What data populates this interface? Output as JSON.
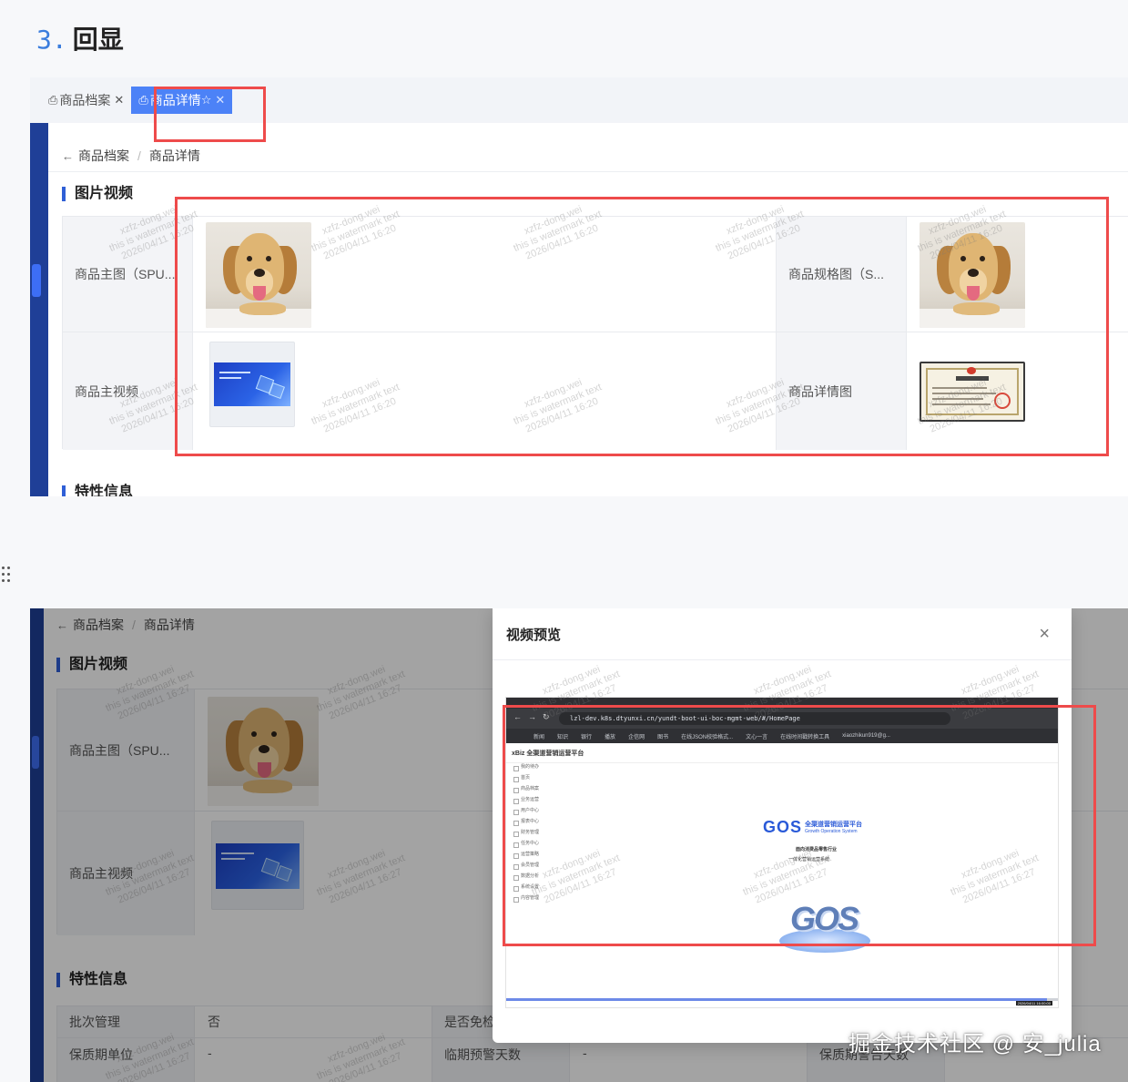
{
  "heading": {
    "number": "3.",
    "title": "回显"
  },
  "screenshot1": {
    "tabs": [
      {
        "label": "商品档案",
        "active": false
      },
      {
        "label": "商品详情",
        "active": true
      }
    ],
    "breadcrumb": {
      "back": "←",
      "parent": "商品档案",
      "separator": "/",
      "current": "商品详情"
    },
    "section_media": "图片视频",
    "section_attrs_partial": "特性信息",
    "rows": [
      {
        "label_left": "商品主图（SPU...",
        "label_right": "商品规格图（S..."
      },
      {
        "label_left": "商品主视频",
        "label_right": "商品详情图"
      }
    ]
  },
  "screenshot2": {
    "breadcrumb": {
      "back": "←",
      "parent": "商品档案",
      "separator": "/",
      "current": "商品详情"
    },
    "section_media": "图片视频",
    "rows": [
      {
        "label": "商品主图（SPU..."
      },
      {
        "label": "商品主视频"
      }
    ],
    "section_attrs": "特性信息",
    "attr_rows": [
      {
        "label1": "批次管理",
        "value1": "否",
        "label2": "是否免检",
        "value2": ""
      },
      {
        "label1": "保质期单位",
        "value1": "-",
        "label2": "临期预警天数",
        "value2": "-",
        "label3": "保质期警告天数"
      }
    ],
    "modal": {
      "title": "视频预览",
      "close": "×",
      "video": {
        "url": "lzl-dev.k8s.dtyunxi.cn/yundt-boot-ui-boc-mgmt-web/#/HomePage",
        "bookmarks": [
          "新闻",
          "知识",
          "银行",
          "播放",
          "企信网",
          "图书",
          "在线JSON校验格式...",
          "文心一言",
          "在线时间戳转换工具",
          "xiaozhikun919@g..."
        ],
        "app_logo": "xBiz 全渠道营销运营平台",
        "menu": [
          "我的待办",
          "首页",
          "商品档案",
          "业务运营",
          "用户中心",
          "报表中心",
          "财务管理",
          "任务中心",
          "运营策略",
          "会员管理",
          "数据分析",
          "系统设置",
          "内容管理"
        ],
        "gos_title": "GOS",
        "gos_cn": "全渠道营销运营平台",
        "gos_en": "Growth Operation System",
        "slogan1": "面向消费品零售行业",
        "slogan2": "一体化营销运营系统",
        "progress": 0.98,
        "timestamp": "2026/04/11 16:00:00"
      }
    }
  },
  "watermark_text": "xzfz-dong.wei\nthis is watermark text\n2026/04/11 16:20",
  "watermark_text2": "xzfz-dong.wei\nthis is watermark text\n2026/04/11 16:27",
  "footer_brand": "掘金技术社区 @ 安_julia",
  "colors": {
    "annotation": "#ee4b4b",
    "sidebar": "#1f3f97",
    "active_tab": "#4c82f7",
    "accent": "#2f5fd6"
  }
}
